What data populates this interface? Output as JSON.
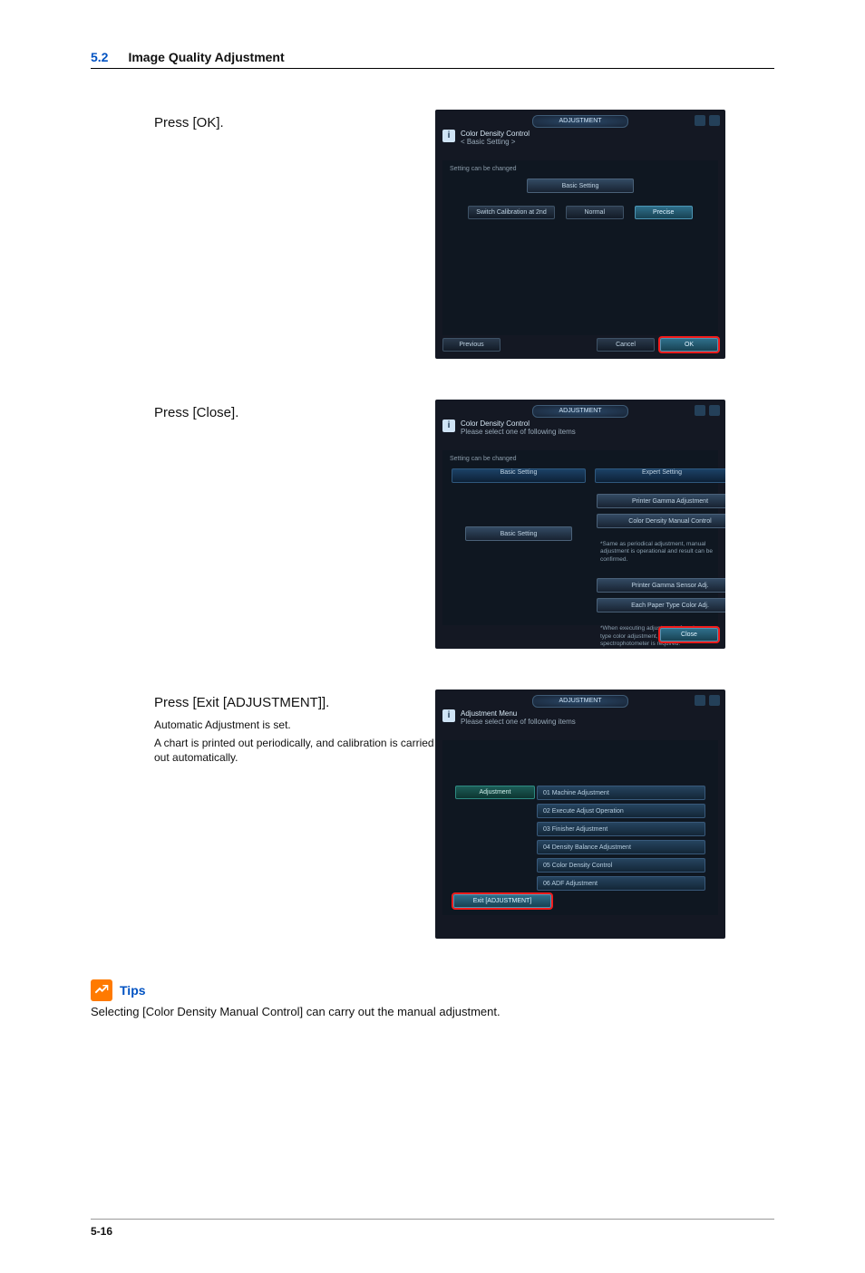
{
  "page": {
    "section_number": "5.2",
    "section_title": "Image Quality Adjustment",
    "footer": "5-16"
  },
  "steps": {
    "a": {
      "heading": "Press [OK]."
    },
    "b": {
      "heading": "Press [Close]."
    },
    "c": {
      "heading": "Press [Exit [ADJUSTMENT]].",
      "line1": "Automatic Adjustment is set.",
      "line2": "A chart is printed out periodically, and calibration is carried out automatically."
    }
  },
  "shot1": {
    "topband": "ADJUSTMENT",
    "title1": "Color Density Control",
    "title2": "< Basic Setting >",
    "hint": "Setting can be changed",
    "section_tab": "Basic Setting",
    "switch_label": "Switch Calibration at 2nd",
    "normal": "Normal",
    "precise": "Precise",
    "previous": "Previous",
    "cancel": "Cancel",
    "ok": "OK"
  },
  "shot2": {
    "topband": "ADJUSTMENT",
    "title1": "Color Density Control",
    "title2": "Please select one of following items",
    "hint": "Setting can be changed",
    "left_tab": "Basic Setting",
    "right_tab": "Expert Setting",
    "basic_btn": "Basic Setting",
    "r_item1": "Printer Gamma Adjustment",
    "r_item2": "Color Density Manual Control",
    "r_note1": "*Same as periodical adjustment, manual adjustment is operational and result can be confirmed.",
    "r_item3": "Printer Gamma Sensor Adj.",
    "r_item4": "Each Paper Type Color Adj.",
    "r_note2": "*When executing adjustment of each paper type color adjustment, external spectrophotometer is required.",
    "close": "Close"
  },
  "shot3": {
    "topband": "ADJUSTMENT",
    "title1": "Adjustment Menu",
    "title2": "Please select one of following items",
    "left_cat": "Adjustment",
    "m1": "01 Machine Adjustment",
    "m2": "02 Execute Adjust Operation",
    "m3": "03 Finisher Adjustment",
    "m4": "04 Density Balance Adjustment",
    "m5": "05 Color Density Control",
    "m6": "06 ADF Adjustment",
    "exit": "Exit [ADJUSTMENT]"
  },
  "tips": {
    "label": "Tips",
    "body": "Selecting [Color Density Manual Control] can carry out the manual adjustment."
  }
}
